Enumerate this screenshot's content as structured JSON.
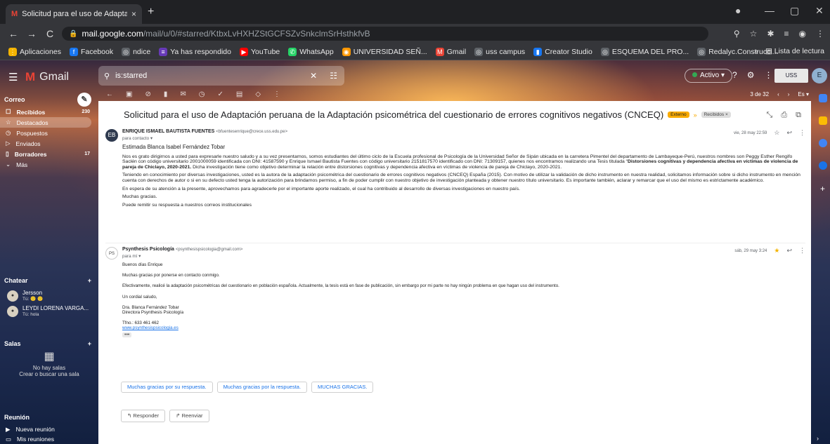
{
  "browser": {
    "tab_title": "Solicitud para el uso de Adaptac",
    "tab_close": "×",
    "new_tab": "+",
    "win": {
      "min": "—",
      "max": "▢",
      "close": "✕"
    },
    "url_host": "mail.google.com",
    "url_path": "/mail/u/0/#starred/KtbxLvHXHZStGCFSZvSnkclmSrHsthkfvB",
    "bookmarks": [
      {
        "label": "Aplicaciones",
        "color": "#f4b400",
        "glyph": "⋮"
      },
      {
        "label": "Facebook",
        "color": "#1877f2",
        "glyph": "f"
      },
      {
        "label": "ndice",
        "color": "#5f6368",
        "glyph": "◎"
      },
      {
        "label": "Ya has respondido",
        "color": "#673ab7",
        "glyph": "≡"
      },
      {
        "label": "YouTube",
        "color": "#ff0000",
        "glyph": "▶"
      },
      {
        "label": "WhatsApp",
        "color": "#25d366",
        "glyph": "✆"
      },
      {
        "label": "UNIVERSIDAD SEÑ...",
        "color": "#ff9800",
        "glyph": "◉"
      },
      {
        "label": "Gmail",
        "color": "#ea4335",
        "glyph": "M"
      },
      {
        "label": "uss campus",
        "color": "#5f6368",
        "glyph": "◎"
      },
      {
        "label": "Creator Studio",
        "color": "#1877f2",
        "glyph": "▮"
      },
      {
        "label": "ESQUEMA DEL PRO...",
        "color": "#5f6368",
        "glyph": "◎"
      },
      {
        "label": "Redalyc.Construcci...",
        "color": "#5f6368",
        "glyph": "◎"
      }
    ],
    "more": "»",
    "reading_list": "Lista de lectura"
  },
  "gmail": {
    "logo_text": "Gmail",
    "search_value": "is:starred",
    "search_clear": "✕",
    "status": "Activo ▾",
    "uss_logo": "USS",
    "sidebar": {
      "correo": "Correo",
      "items": [
        {
          "label": "Recibidos",
          "count": "230",
          "icon": "☐"
        },
        {
          "label": "Destacados",
          "count": "",
          "icon": "☆"
        },
        {
          "label": "Pospuestos",
          "count": "",
          "icon": "◷"
        },
        {
          "label": "Enviados",
          "count": "",
          "icon": "▷"
        },
        {
          "label": "Borradores",
          "count": "17",
          "icon": "▯"
        },
        {
          "label": "Más",
          "count": "",
          "icon": "⌄"
        }
      ],
      "chatear": "Chatear",
      "chats": [
        {
          "name": "Jersson",
          "status": "Tú: 🙂 🙂"
        },
        {
          "name": "LEYDI LORENA VARGA...",
          "status": "Tú: hola"
        }
      ],
      "salas": "Salas",
      "no_salas": "No hay salas",
      "crear_sala": "Crear o buscar una sala",
      "reunion": "Reunión",
      "reunion_items": [
        {
          "label": "Nueva reunión",
          "icon": "▶"
        },
        {
          "label": "Mis reuniones",
          "icon": "▭"
        }
      ]
    },
    "pagination": "3 de 32",
    "lang": "Es ▾",
    "subject": "Solicitud para el uso de Adaptación peruana de la Adaptación psicométrica del cuestionario de errores cognitivos negativos (CNCEQ)",
    "badge_externo": "Externo",
    "badge_recibidos": "Recibidos ×",
    "msg1": {
      "sender": "ENRIQUE ISMAEL BAUTISTA FUENTES",
      "email": "<bfuentesenrique@crece.uss.edu.pe>",
      "to": "para contacto ▾",
      "date": "vie, 28 may 22:59",
      "greeting": "Estimada Blanca Isabel Fernández Tobar",
      "p1_a": "Nos es grato dirigirnos a usted para expresarle nuestro saludo y a su vez presentarnos, somos estudiantes del último ciclo de la Escuela profesional de Psicología de la Universidad Señor de Sipán ubicada en la carretera Pimentel del departamento de Lambayeque-Perú, nuestros nombres son Peggy Esther Rengifo Saclén con código universitario 2001000059 identificada con DNI: 41587590 y Enrique Ismael Bautista Fuentes con código universitario 2151817570 identificado con DNI: 71309157, quienes nos encontramos realizando una Tesis titulada “",
      "p1_b": "Distorsiones cognitivas y dependencia afectiva en víctimas de violencia de pareja de Chiclayo, 2020-2021.",
      "p1_c": " Dicha investigación tiene como objetivo determinar la relación entre distorsiones cognitivas y dependencia afectiva en víctimas de violencia de pareja de Chiclayo, 2020-2021.",
      "p2": "Teniendo en conocimiento por diversas investigaciones, usted es la autora de la adaptación psicométrica del cuestionario de errores cognitivos negativos (CNCEQ) España (2015). Con motivo de utilizar la validación de dicho instrumento en nuestra realidad, solicitamos información sobre si dicho instrumento en mención cuenta con derechos de autor o si en su defecto usted tenga la autorización para brindarnos permiso, a fin de poder cumplir con nuestro objetivo de investigación planteada y obtener nuestro título universitario. Es importante también, aclarar y remarcar que el uso del mismo es estrictamente académico.",
      "p3": "En espera de su atención a la presente, aprovechamos para agradecerle por el importante aporte realizado, el cual ha contribuido al desarrollo de diversas investigaciones en nuestro país.",
      "p4": "Muchas gracias.",
      "p5": "Puede remitir su respuesta a nuestros correos institucionales"
    },
    "msg2": {
      "sender": "Psynthesis Psicología",
      "email": "<psynthesispsicologia@gmail.com>",
      "to": "para mí ▾",
      "date": "sáb, 29 may 3:24",
      "l1": "Buenos días Enrique",
      "l2": "Muchas gracias por ponerse en contacto conmigo.",
      "l3": "Efectivamente, realicé la adaptación psicométricas del cuestionario en población española. Actualmente, la tesis está en fase de publicación, sin embargo por mi parte no hay ningún problema en que hagan uso del instrumento.",
      "l4": "Un cordial saludo,",
      "sig1": "Dra. Blanca Fernández Tobar",
      "sig2": "Directora Psynthesis Psicología",
      "tel": "Tfno.: 633 461 462",
      "web": "www.psynthesispsicologia.es",
      "dots": "•••"
    },
    "smart_replies": [
      "Muchas gracias por su respuesta.",
      "Muchas gracias por la respuesta.",
      "MUCHAS GRACIAS."
    ],
    "reply": "Responder",
    "forward": "Reenviar"
  }
}
